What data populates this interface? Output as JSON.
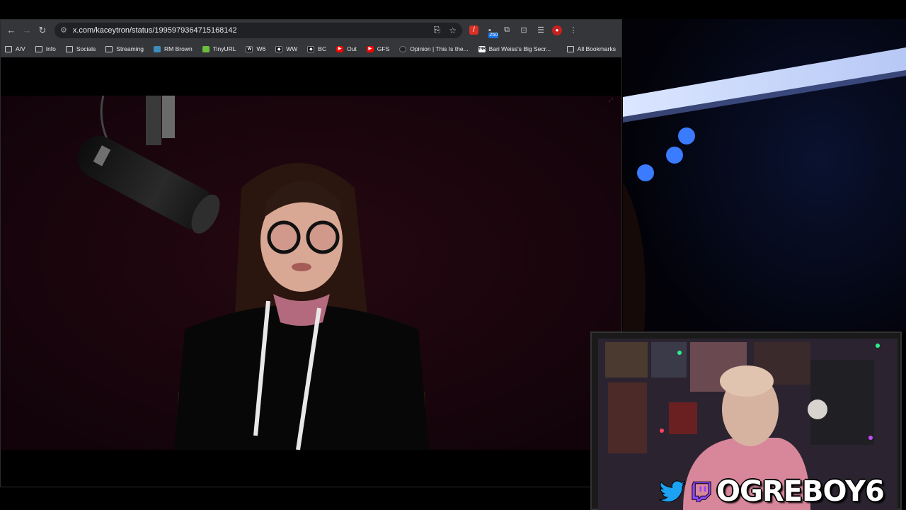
{
  "browser": {
    "address_bar": {
      "url": "x.com/kaceytron/status/1995979364715168142"
    },
    "extensions": {
      "badge_count": "250"
    },
    "bookmarks": [
      {
        "label": "A/V",
        "icon": "folder-icon"
      },
      {
        "label": "Info",
        "icon": "folder-icon"
      },
      {
        "label": "Socials",
        "icon": "folder-icon"
      },
      {
        "label": "Streaming",
        "icon": "folder-icon"
      },
      {
        "label": "RM Brown",
        "icon": "site-favicon-icon",
        "color": "#3c8dbc"
      },
      {
        "label": "TinyURL",
        "icon": "tinyurl-favicon-icon",
        "color": "#6cbf3a"
      },
      {
        "label": "W6",
        "icon": "w-favicon-icon",
        "color": "#111111"
      },
      {
        "label": "WW",
        "icon": "ww-favicon-icon",
        "color": "#111111"
      },
      {
        "label": "BC",
        "icon": "bc-favicon-icon",
        "color": "#111111"
      },
      {
        "label": "Out",
        "icon": "youtube-favicon-icon",
        "color": "#ff0000"
      },
      {
        "label": "GFS",
        "icon": "youtube-favicon-icon",
        "color": "#ff0000"
      },
      {
        "label": "Opinion | This Is the...",
        "icon": "globe-favicon-icon",
        "color": "#222222"
      },
      {
        "label": "Bari Weiss's Big Secr...",
        "icon": "tnr-favicon-icon",
        "color": "#ffffff"
      }
    ],
    "all_bookmarks_label": "All Bookmarks"
  },
  "overlay": {
    "handle": "OGREBOY6",
    "twitter_color": "#1da1f2",
    "twitch_color": "#9146ff"
  }
}
